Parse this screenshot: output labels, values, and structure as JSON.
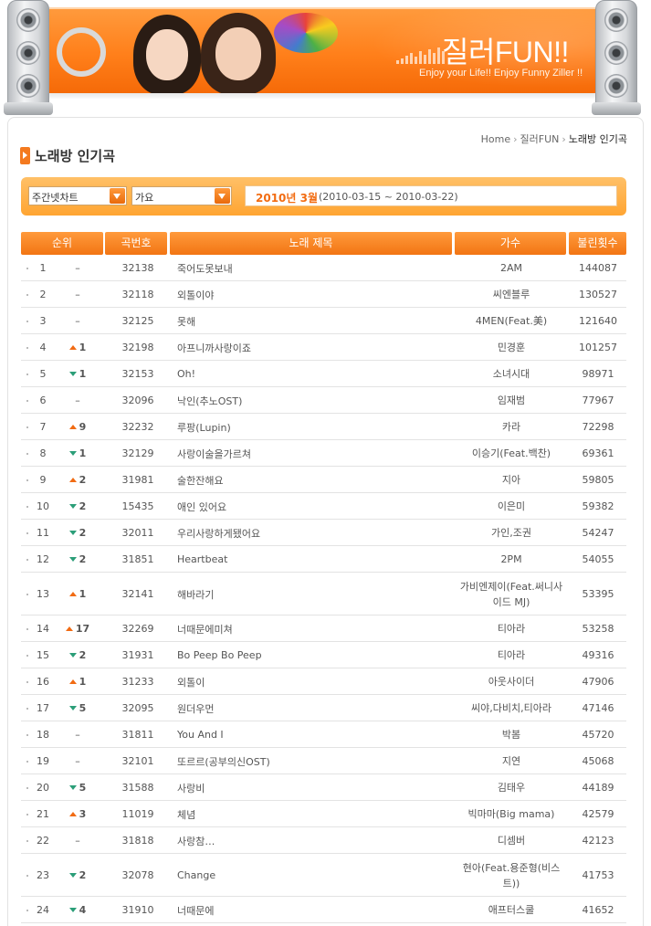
{
  "banner": {
    "title": "질러FUN!!",
    "subtitle": "Enjoy your Life!! Enjoy Funny Ziller !!"
  },
  "breadcrumb": {
    "home": "Home",
    "section": "질러FUN",
    "current": "노래방 인기곡"
  },
  "page": {
    "title": "노래방 인기곡"
  },
  "filters": {
    "chart_type": "주간넷차트",
    "genre": "가요",
    "period_year_month": "2010년 3월",
    "period_range": "(2010-03-15 ~ 2010-03-22)"
  },
  "table": {
    "headers": {
      "rank": "순위",
      "number": "곡번호",
      "title": "노래 제목",
      "artist": "가수",
      "count": "불린횟수"
    },
    "rows": [
      {
        "rank": "1",
        "dir": "none",
        "change": "–",
        "number": "32138",
        "title": "죽어도못보내",
        "artist": "2AM",
        "count": "144087"
      },
      {
        "rank": "2",
        "dir": "none",
        "change": "–",
        "number": "32118",
        "title": "외톨이야",
        "artist": "씨엔블루",
        "count": "130527"
      },
      {
        "rank": "3",
        "dir": "none",
        "change": "–",
        "number": "32125",
        "title": "못해",
        "artist": "4MEN(Feat.美)",
        "count": "121640"
      },
      {
        "rank": "4",
        "dir": "up",
        "change": "1",
        "number": "32198",
        "title": "아프니까사랑이죠",
        "artist": "민경훈",
        "count": "101257"
      },
      {
        "rank": "5",
        "dir": "down",
        "change": "1",
        "number": "32153",
        "title": "Oh!",
        "artist": "소녀시대",
        "count": "98971"
      },
      {
        "rank": "6",
        "dir": "none",
        "change": "–",
        "number": "32096",
        "title": "낙인(추노OST)",
        "artist": "임재범",
        "count": "77967"
      },
      {
        "rank": "7",
        "dir": "up",
        "change": "9",
        "number": "32232",
        "title": "루팡(Lupin)",
        "artist": "카라",
        "count": "72298"
      },
      {
        "rank": "8",
        "dir": "down",
        "change": "1",
        "number": "32129",
        "title": "사랑이술을가르쳐",
        "artist": "이승기(Feat.백찬)",
        "count": "69361"
      },
      {
        "rank": "9",
        "dir": "up",
        "change": "2",
        "number": "31981",
        "title": "술한잔해요",
        "artist": "지아",
        "count": "59805"
      },
      {
        "rank": "10",
        "dir": "down",
        "change": "2",
        "number": "15435",
        "title": "애인 있어요",
        "artist": "이은미",
        "count": "59382"
      },
      {
        "rank": "11",
        "dir": "down",
        "change": "2",
        "number": "32011",
        "title": "우리사랑하게됐어요",
        "artist": "가인,조권",
        "count": "54247"
      },
      {
        "rank": "12",
        "dir": "down",
        "change": "2",
        "number": "31851",
        "title": "Heartbeat",
        "artist": "2PM",
        "count": "54055"
      },
      {
        "rank": "13",
        "dir": "up",
        "change": "1",
        "number": "32141",
        "title": "해바라기",
        "artist": "가비엔제이(Feat.써니사이드 MJ)",
        "count": "53395"
      },
      {
        "rank": "14",
        "dir": "up",
        "change": "17",
        "number": "32269",
        "title": "너때문에미쳐",
        "artist": "티아라",
        "count": "53258"
      },
      {
        "rank": "15",
        "dir": "down",
        "change": "2",
        "number": "31931",
        "title": "Bo Peep Bo Peep",
        "artist": "티아라",
        "count": "49316"
      },
      {
        "rank": "16",
        "dir": "up",
        "change": "1",
        "number": "31233",
        "title": "외톨이",
        "artist": "아웃사이더",
        "count": "47906"
      },
      {
        "rank": "17",
        "dir": "down",
        "change": "5",
        "number": "32095",
        "title": "원더우먼",
        "artist": "씨야,다비치,티아라",
        "count": "47146"
      },
      {
        "rank": "18",
        "dir": "none",
        "change": "–",
        "number": "31811",
        "title": "You And I",
        "artist": "박봄",
        "count": "45720"
      },
      {
        "rank": "19",
        "dir": "none",
        "change": "–",
        "number": "32101",
        "title": "또르르(공부의신OST)",
        "artist": "지연",
        "count": "45068"
      },
      {
        "rank": "20",
        "dir": "down",
        "change": "5",
        "number": "31588",
        "title": "사랑비",
        "artist": "김태우",
        "count": "44189"
      },
      {
        "rank": "21",
        "dir": "up",
        "change": "3",
        "number": "11019",
        "title": "체념",
        "artist": "빅마마(Big mama)",
        "count": "42579"
      },
      {
        "rank": "22",
        "dir": "none",
        "change": "–",
        "number": "31818",
        "title": "사랑참…",
        "artist": "디셈버",
        "count": "42123"
      },
      {
        "rank": "23",
        "dir": "down",
        "change": "2",
        "number": "32078",
        "title": "Change",
        "artist": "현아(Feat.용준형(비스트))",
        "count": "41753"
      },
      {
        "rank": "24",
        "dir": "down",
        "change": "4",
        "number": "31910",
        "title": "너때문에",
        "artist": "애프터스쿨",
        "count": "41652"
      }
    ]
  },
  "colors": {
    "accent": "#f47a1f",
    "up": "#f16b13",
    "down": "#2b9e78",
    "header_bg": "#ff9a3c",
    "filter_bg": "#ffb84d"
  }
}
